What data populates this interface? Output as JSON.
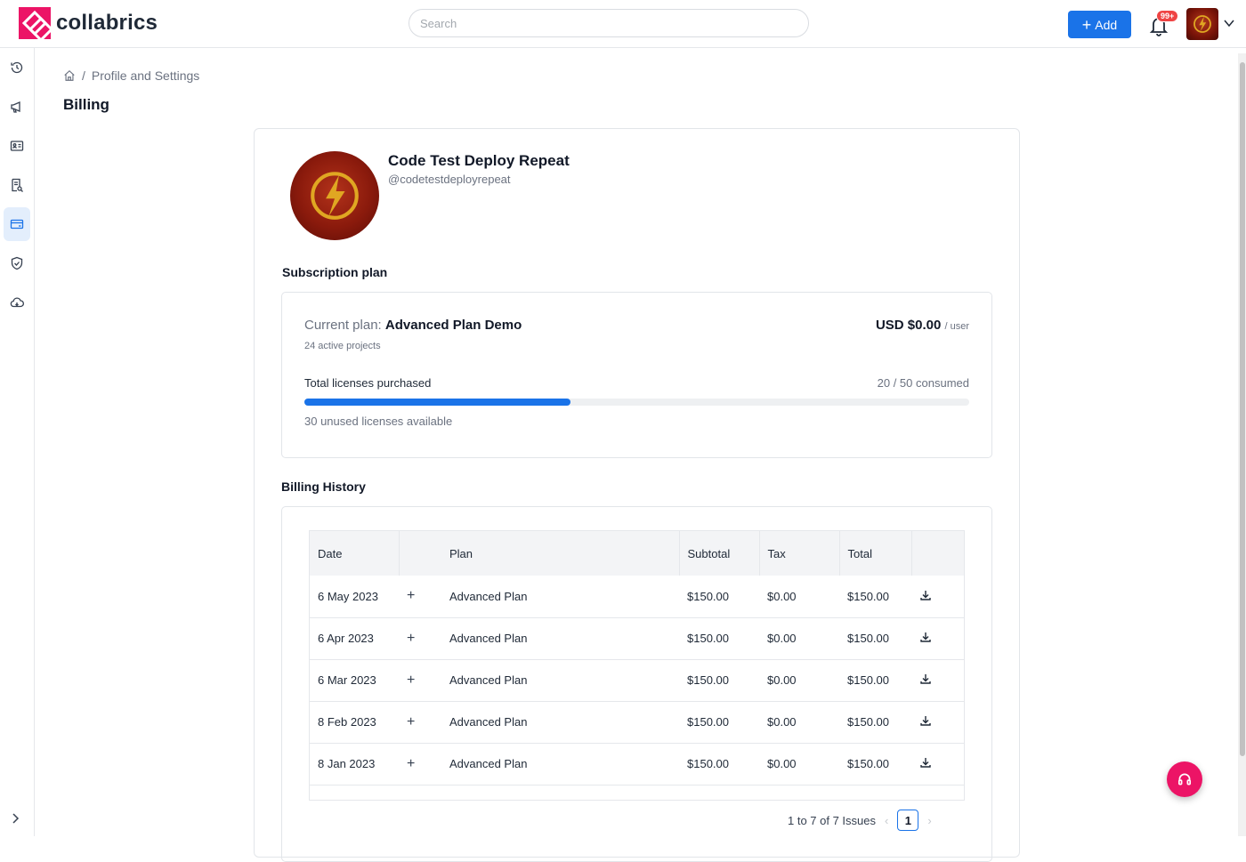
{
  "header": {
    "brand": "collabrics",
    "search_placeholder": "Search",
    "add_label": "Add",
    "notification_count": "99+"
  },
  "sidebar": {
    "items": [
      {
        "icon": "history-icon"
      },
      {
        "icon": "megaphone-icon"
      },
      {
        "icon": "id-card-icon"
      },
      {
        "icon": "report-icon"
      },
      {
        "icon": "billing-card-icon",
        "active": true
      },
      {
        "icon": "shield-check-icon"
      },
      {
        "icon": "cloud-icon"
      }
    ]
  },
  "breadcrumb": {
    "section": "Profile and Settings"
  },
  "page_title": "Billing",
  "org": {
    "name": "Code Test Deploy Repeat",
    "handle": "@codetestdeployrepeat"
  },
  "subscription": {
    "title": "Subscription plan",
    "current_plan_label": "Current plan:",
    "plan_name": "Advanced Plan Demo",
    "projects": "24 active projects",
    "price": "USD $0.00",
    "price_unit": "/ user",
    "licenses_label": "Total licenses purchased",
    "consumed_text": "20 / 50 consumed",
    "consumed_fraction": 0.4,
    "unused_text": "30 unused licenses available"
  },
  "billing_history": {
    "title": "Billing History",
    "columns": [
      "Date",
      "",
      "Plan",
      "Subtotal",
      "Tax",
      "Total",
      ""
    ],
    "rows": [
      {
        "date": "6 May 2023",
        "plan": "Advanced Plan",
        "subtotal": "$150.00",
        "tax": "$0.00",
        "total": "$150.00"
      },
      {
        "date": "6 Apr 2023",
        "plan": "Advanced Plan",
        "subtotal": "$150.00",
        "tax": "$0.00",
        "total": "$150.00"
      },
      {
        "date": "6 Mar 2023",
        "plan": "Advanced Plan",
        "subtotal": "$150.00",
        "tax": "$0.00",
        "total": "$150.00"
      },
      {
        "date": "8 Feb 2023",
        "plan": "Advanced Plan",
        "subtotal": "$150.00",
        "tax": "$0.00",
        "total": "$150.00"
      },
      {
        "date": "8 Jan 2023",
        "plan": "Advanced Plan",
        "subtotal": "$150.00",
        "tax": "$0.00",
        "total": "$150.00"
      }
    ],
    "pagination_text": "1 to 7 of 7 Issues",
    "current_page": "1"
  },
  "colors": {
    "brand": "#ec1466",
    "accent": "#1a73e8"
  }
}
